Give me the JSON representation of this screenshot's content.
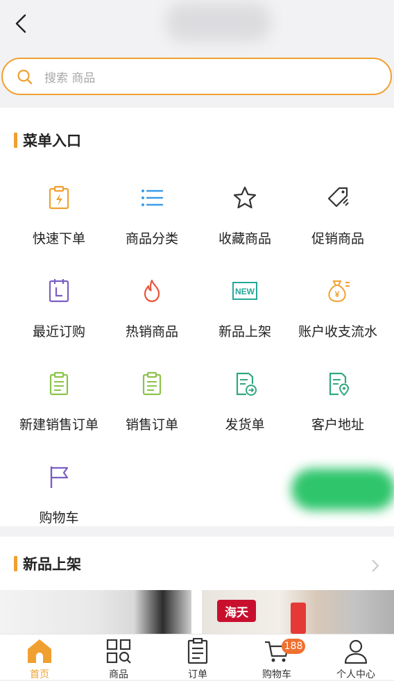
{
  "search": {
    "placeholder": "搜索 商品"
  },
  "menu": {
    "title": "菜单入口",
    "items": [
      {
        "label": "快速下单",
        "icon": "quick-order-icon"
      },
      {
        "label": "商品分类",
        "icon": "list-icon"
      },
      {
        "label": "收藏商品",
        "icon": "star-icon"
      },
      {
        "label": "促销商品",
        "icon": "tag-icon"
      },
      {
        "label": "最近订购",
        "icon": "recent-calendar-icon"
      },
      {
        "label": "热销商品",
        "icon": "fire-icon"
      },
      {
        "label": "新品上架",
        "icon": "new-badge-icon",
        "badge_text": "NEW"
      },
      {
        "label": "账户收支流水",
        "icon": "money-bag-icon",
        "glyph": "¥"
      },
      {
        "label": "新建销售订单",
        "icon": "clipboard-icon"
      },
      {
        "label": "销售订单",
        "icon": "clipboard-icon"
      },
      {
        "label": "发货单",
        "icon": "shipping-doc-icon"
      },
      {
        "label": "客户地址",
        "icon": "address-doc-icon"
      },
      {
        "label": "购物车",
        "icon": "flag-icon"
      }
    ]
  },
  "new_products": {
    "title": "新品上架",
    "brand_text": "海天"
  },
  "tabbar": {
    "items": [
      {
        "label": "首页",
        "icon": "home-icon",
        "active": true
      },
      {
        "label": "商品",
        "icon": "grid-search-icon"
      },
      {
        "label": "订单",
        "icon": "order-list-icon"
      },
      {
        "label": "购物车",
        "icon": "cart-icon",
        "badge": "188"
      },
      {
        "label": "个人中心",
        "icon": "user-icon"
      }
    ]
  },
  "colors": {
    "accent": "#f0a030",
    "blue": "#3b9be8",
    "green": "#2ec56b",
    "purple": "#7a5ec4",
    "red": "#e8553a"
  }
}
